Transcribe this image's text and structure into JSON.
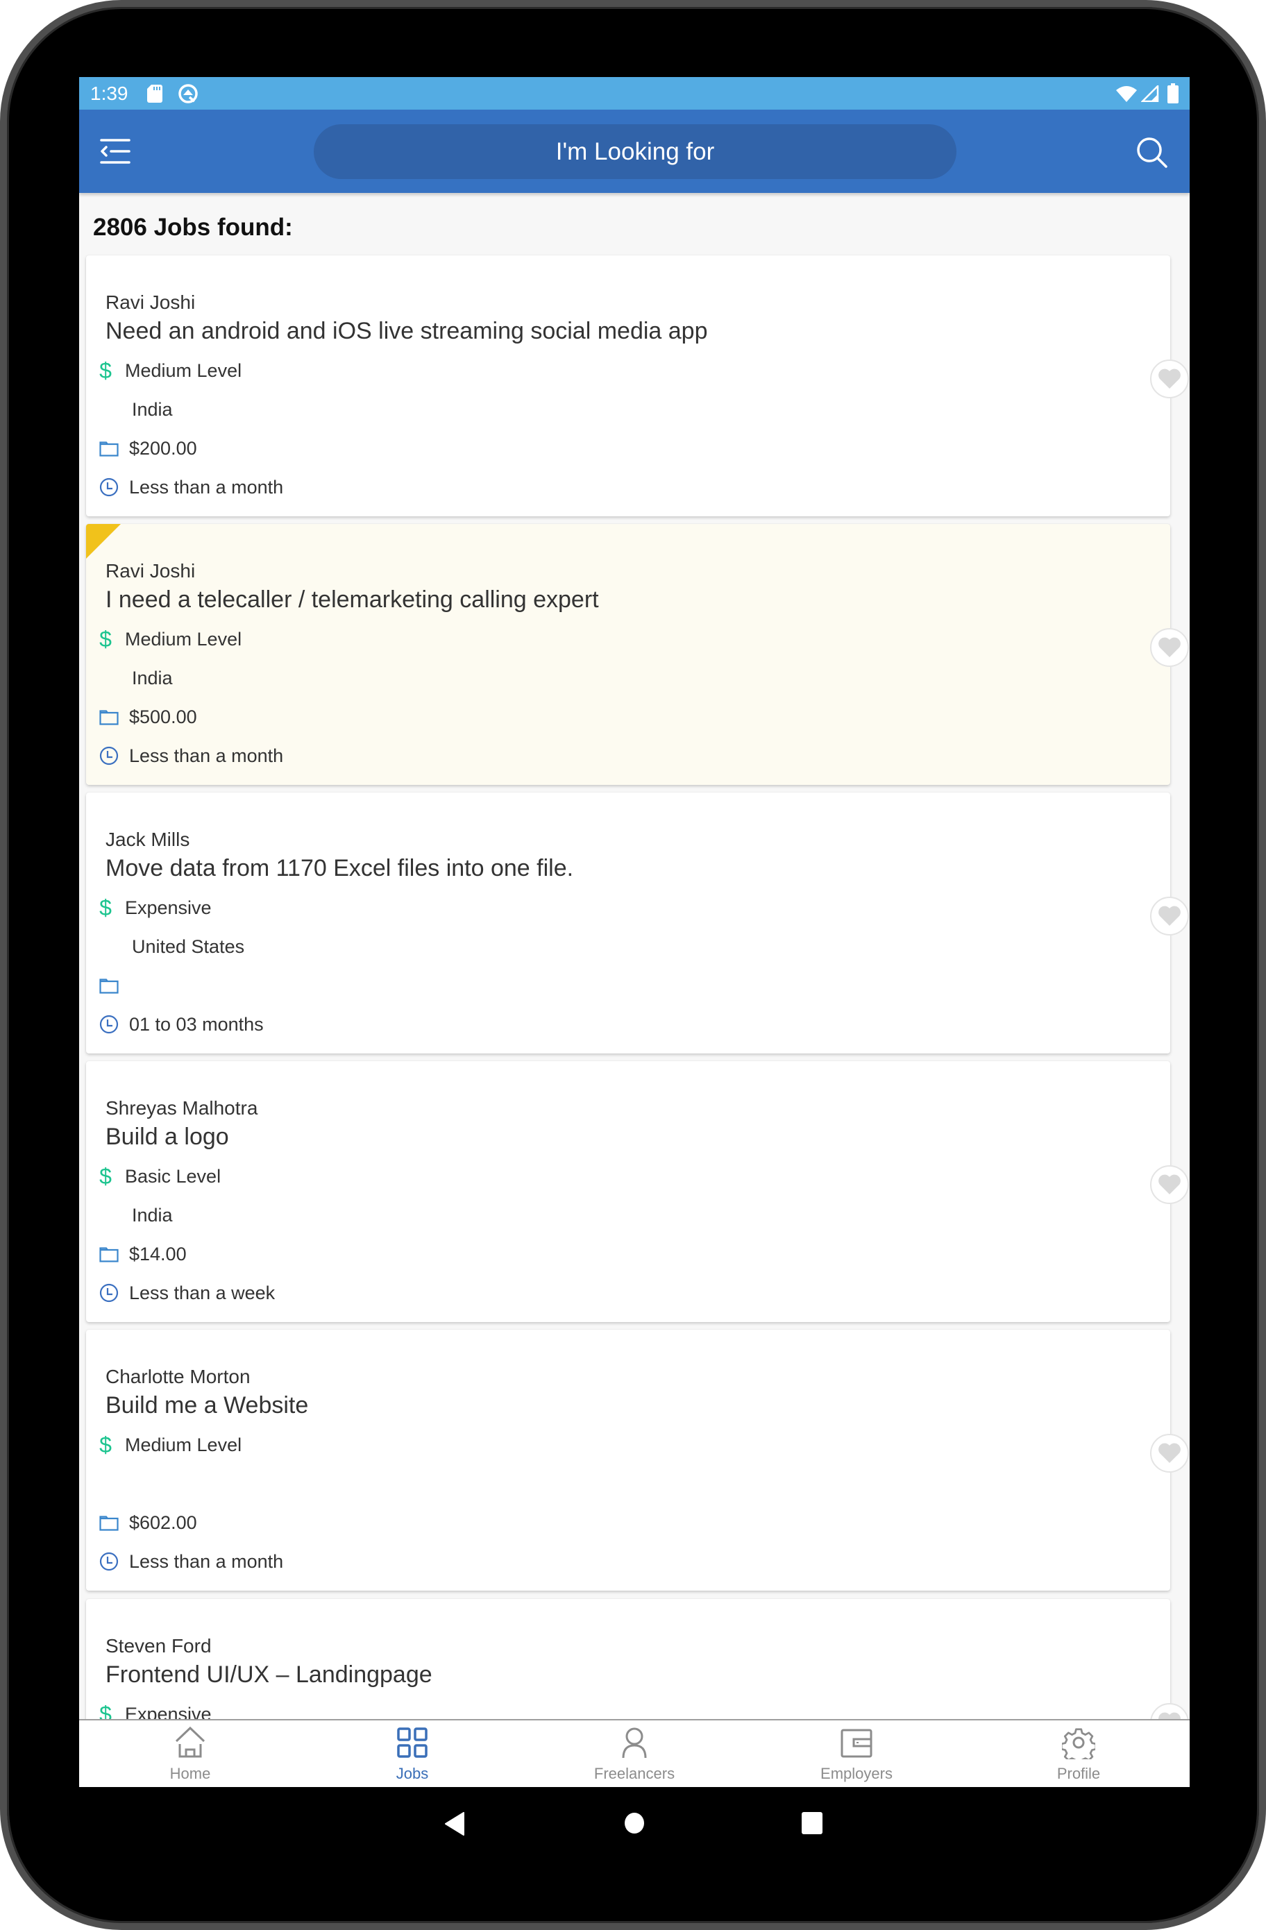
{
  "status_bar": {
    "time": "1:39",
    "icons": [
      "sd-card-icon",
      "sync-icon",
      "wifi-icon",
      "signal-icon",
      "battery-icon"
    ]
  },
  "app_bar": {
    "menu_icon": "menu-back-icon",
    "search_placeholder": "I'm Looking for",
    "search_icon": "search-icon"
  },
  "jobs": {
    "count_label": "2806 Jobs found:",
    "items": [
      {
        "employer": "Ravi Joshi",
        "title": "Need an android and iOS live streaming social media app",
        "level": "Medium Level",
        "location": "India",
        "budget": "$200.00",
        "duration": "Less than a month",
        "featured": false
      },
      {
        "employer": "Ravi Joshi",
        "title": "I need a telecaller / telemarketing calling expert",
        "level": "Medium Level",
        "location": "India",
        "budget": "$500.00",
        "duration": "Less than a month",
        "featured": true
      },
      {
        "employer": "Jack Mills",
        "title": "Move data from 1170 Excel files into one file.",
        "level": "Expensive",
        "location": "United States",
        "budget": "",
        "duration": "01 to 03 months",
        "featured": false
      },
      {
        "employer": "Shreyas Malhotra",
        "title": "Build a logo",
        "level": "Basic Level",
        "location": "India",
        "budget": "$14.00",
        "duration": "Less than a week",
        "featured": false
      },
      {
        "employer": "Charlotte Morton",
        "title": "Build me a Website",
        "level": "Medium Level",
        "location": "",
        "budget": "$602.00",
        "duration": "Less than a month",
        "featured": false
      },
      {
        "employer": "Steven Ford",
        "title": "Frontend UI/UX – Landingpage",
        "level": "Expensive",
        "location": "",
        "budget": "",
        "duration": "",
        "featured": false
      }
    ]
  },
  "bottom_nav": {
    "items": [
      {
        "label": "Home",
        "icon": "home-icon",
        "active": false
      },
      {
        "label": "Jobs",
        "icon": "grid-icon",
        "active": true
      },
      {
        "label": "Freelancers",
        "icon": "person-icon",
        "active": false
      },
      {
        "label": "Employers",
        "icon": "wallet-icon",
        "active": false
      },
      {
        "label": "Profile",
        "icon": "gear-icon",
        "active": false
      }
    ]
  },
  "system_nav": {
    "buttons": [
      "back",
      "home",
      "recents"
    ]
  },
  "colors": {
    "status_bar": "#54ACE3",
    "app_bar": "#3672C2",
    "search_pill": "#3163A9",
    "level_icon": "#1CC48F",
    "detail_icon": "#3A86CC",
    "featured_ribbon": "#F1C21B",
    "featured_bg": "#FDFBF1",
    "nav_active": "#3A6FB8"
  }
}
